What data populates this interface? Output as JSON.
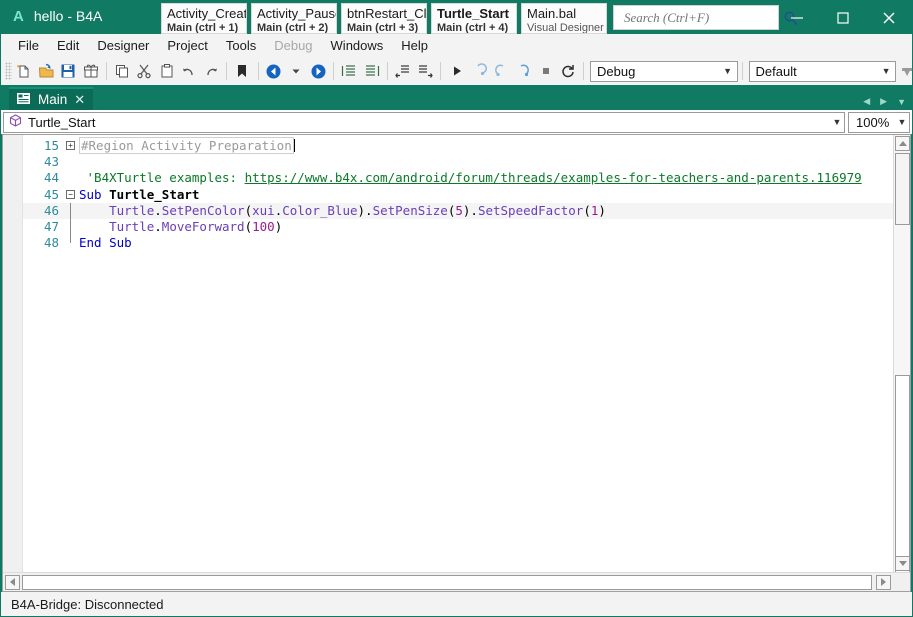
{
  "window": {
    "app_badge": "A",
    "title": "hello - B4A",
    "minimize_label": "—",
    "maximize_label": "□",
    "close_label": "✕"
  },
  "quick_tabs": [
    {
      "name": "Activity_Creat",
      "sub": "Main  (ctrl + 1)",
      "active": false,
      "bold_sub": true
    },
    {
      "name": "Activity_Pause",
      "sub": "Main  (ctrl + 2)",
      "active": false,
      "bold_sub": true
    },
    {
      "name": "btnRestart_Cl",
      "sub": "Main  (ctrl + 3)",
      "active": false,
      "bold_sub": true
    },
    {
      "name": "Turtle_Start",
      "sub": "Main  (ctrl + 4)",
      "active": true,
      "bold_sub": true
    },
    {
      "name": "Main.bal",
      "sub": "Visual Designer",
      "active": false,
      "bold_sub": false
    }
  ],
  "search": {
    "placeholder": "Search (Ctrl+F)",
    "value": "",
    "icon": "search-icon"
  },
  "menubar": [
    {
      "label": "File",
      "disabled": false
    },
    {
      "label": "Edit",
      "disabled": false
    },
    {
      "label": "Designer",
      "disabled": false
    },
    {
      "label": "Project",
      "disabled": false
    },
    {
      "label": "Tools",
      "disabled": false
    },
    {
      "label": "Debug",
      "disabled": true
    },
    {
      "label": "Windows",
      "disabled": false
    },
    {
      "label": "Help",
      "disabled": false
    }
  ],
  "toolbar": {
    "buttons": [
      {
        "icon": "new-file-icon",
        "name": "new-file-button"
      },
      {
        "icon": "open-folder-icon",
        "name": "open-project-button"
      },
      {
        "icon": "save-icon",
        "name": "save-button"
      },
      {
        "icon": "package-icon",
        "name": "export-package-button"
      },
      {
        "icon": "copy-icon",
        "name": "copy-button"
      },
      {
        "icon": "cut-icon",
        "name": "cut-button"
      },
      {
        "icon": "paste-icon",
        "name": "paste-button"
      },
      {
        "icon": "undo-icon",
        "name": "undo-button"
      },
      {
        "icon": "redo-icon",
        "name": "redo-button"
      },
      {
        "icon": "bookmark-icon",
        "name": "bookmark-button"
      },
      {
        "icon": "back-arrow-icon",
        "name": "navigate-back-button"
      },
      {
        "icon": "chevron-down-icon",
        "name": "navigate-history-button"
      },
      {
        "icon": "forward-arrow-icon",
        "name": "navigate-forward-button"
      },
      {
        "icon": "indent-icon",
        "name": "indent-button"
      },
      {
        "icon": "outdent-icon",
        "name": "outdent-button"
      },
      {
        "icon": "comment-icon",
        "name": "comment-button"
      },
      {
        "icon": "uncomment-icon",
        "name": "uncomment-button"
      },
      {
        "icon": "run-icon",
        "name": "run-button"
      },
      {
        "icon": "step-into-icon",
        "name": "step-into-button"
      },
      {
        "icon": "step-over-icon",
        "name": "step-over-button"
      },
      {
        "icon": "step-out-icon",
        "name": "step-out-button"
      },
      {
        "icon": "stop-icon",
        "name": "stop-button"
      },
      {
        "icon": "restart-icon",
        "name": "restart-button"
      }
    ],
    "build_mode": "Debug",
    "build_config": "Default",
    "overflow_icon": "overflow-chevron-icon"
  },
  "doc_tabs": {
    "tabs": [
      {
        "label": "Main",
        "icon": "code-module-icon",
        "close": "✕"
      }
    ],
    "nav_prev": "◀",
    "nav_next": "▶",
    "nav_menu": "▼"
  },
  "member_bar": {
    "icon": "method-cube-icon",
    "selected": "Turtle_Start",
    "arrow": "▼",
    "zoom": "100%",
    "zoom_arrow": "▼"
  },
  "editor": {
    "lines": [
      {
        "num": "15",
        "fold": "plus",
        "indent": 0,
        "tokens": [
          {
            "cls": "k-region",
            "text": "#Region Activity Preparation",
            "boxed": true
          },
          {
            "cls": "caret",
            "text": ""
          }
        ]
      },
      {
        "num": "43",
        "fold": "",
        "indent": 0,
        "tokens": []
      },
      {
        "num": "44",
        "fold": "",
        "indent": 0,
        "tokens": [
          {
            "cls": "k-cmt",
            "text": " 'B4XTurtle examples: "
          },
          {
            "cls": "k-link",
            "text": "https://www.b4x.com/android/forum/threads/examples-for-teachers-and-parents.116979"
          }
        ]
      },
      {
        "num": "45",
        "fold": "minus",
        "indent": 0,
        "tokens": [
          {
            "cls": "k-key",
            "text": "Sub "
          },
          {
            "cls": "k-name",
            "text": "Turtle_Start"
          }
        ]
      },
      {
        "num": "46",
        "fold": "bar",
        "highlight": true,
        "indent": 0,
        "tokens": [
          {
            "cls": "k-id",
            "text": "    Turtle"
          },
          {
            "cls": "k-plain",
            "text": "."
          },
          {
            "cls": "k-id",
            "text": "SetPenColor"
          },
          {
            "cls": "k-plain",
            "text": "("
          },
          {
            "cls": "k-id",
            "text": "xui"
          },
          {
            "cls": "k-plain",
            "text": "."
          },
          {
            "cls": "k-id",
            "text": "Color_Blue"
          },
          {
            "cls": "k-plain",
            "text": ")."
          },
          {
            "cls": "k-id",
            "text": "SetPenSize"
          },
          {
            "cls": "k-plain",
            "text": "("
          },
          {
            "cls": "k-num",
            "text": "5"
          },
          {
            "cls": "k-plain",
            "text": ")."
          },
          {
            "cls": "k-id",
            "text": "SetSpeedFactor"
          },
          {
            "cls": "k-plain",
            "text": "("
          },
          {
            "cls": "k-num",
            "text": "1"
          },
          {
            "cls": "k-plain",
            "text": ")"
          }
        ]
      },
      {
        "num": "47",
        "fold": "bar",
        "indent": 0,
        "tokens": [
          {
            "cls": "k-id",
            "text": "    Turtle"
          },
          {
            "cls": "k-plain",
            "text": "."
          },
          {
            "cls": "k-id",
            "text": "MoveForward"
          },
          {
            "cls": "k-plain",
            "text": "("
          },
          {
            "cls": "k-num",
            "text": "100"
          },
          {
            "cls": "k-plain",
            "text": ")"
          }
        ]
      },
      {
        "num": "48",
        "fold": "end",
        "indent": 0,
        "tokens": [
          {
            "cls": "k-key",
            "text": "End Sub"
          }
        ]
      }
    ]
  },
  "scrollbars": {
    "v_up": "▲",
    "v_down": "▼",
    "h_left": "◀",
    "h_right": "▶"
  },
  "statusbar": {
    "text": "B4A-Bridge: Disconnected"
  },
  "colors": {
    "title_bg": "#107a63",
    "accent": "#0c7a64",
    "keyword": "#0000d0",
    "identifier": "#6a3fb5",
    "number": "#9b1a8b",
    "comment": "#0b7a28",
    "linenumber": "#2e8b9e"
  }
}
